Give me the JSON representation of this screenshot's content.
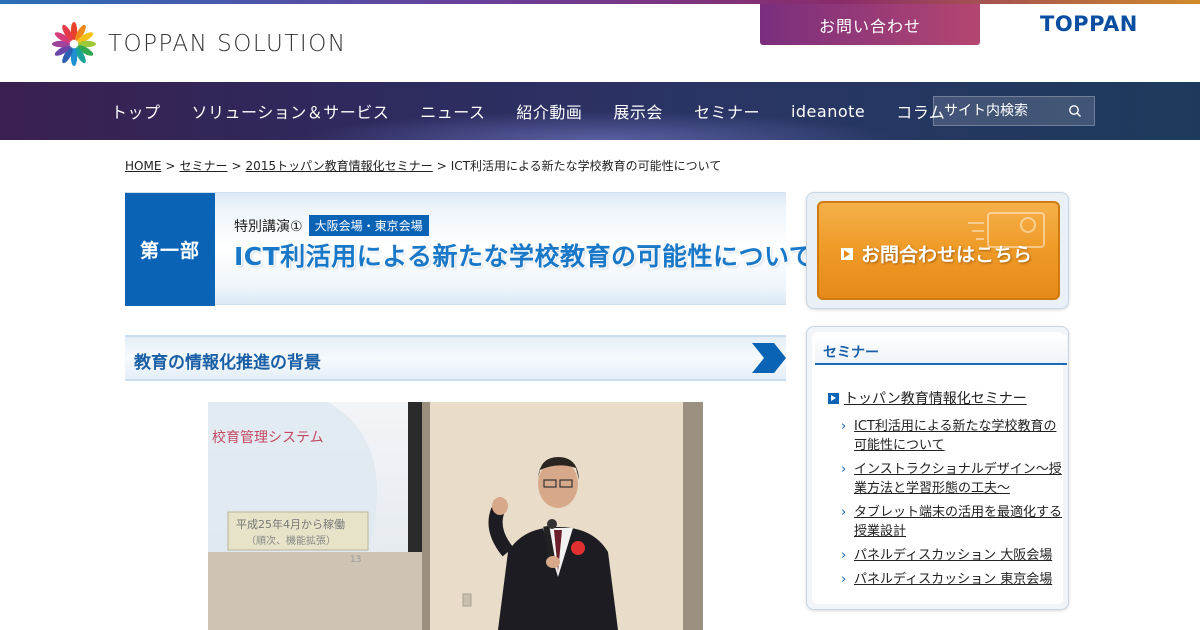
{
  "header": {
    "logo_text": "TOPPAN SOLUTION",
    "contact_button": "お問い合わせ",
    "brand": "TOPPAN"
  },
  "nav": {
    "items": [
      "トップ",
      "ソリューション＆サービス",
      "ニュース",
      "紹介動画",
      "展示会",
      "セミナー",
      "ideanote",
      "コラム"
    ],
    "search_placeholder": "サイト内検索"
  },
  "breadcrumb": {
    "items": [
      "HOME",
      "セミナー",
      "2015トッパン教育情報化セミナー"
    ],
    "current": "ICT利活用による新たな学校教育の可能性について",
    "separator": ">"
  },
  "banner": {
    "part": "第一部",
    "subtitle": "特別講演①",
    "venue": "大阪会場・東京会場",
    "title": "ICT利活用による新たな学校教育の可能性について"
  },
  "section": {
    "heading": "教育の情報化推進の背景"
  },
  "photo": {
    "slide_text": "校育管理システム",
    "slide_box_line1": "平成25年4月から稼働",
    "slide_box_line2": "（順次、機能拡張）",
    "slide_number": "13"
  },
  "sidebar": {
    "contact_label": "お問合わせはこちら",
    "menu_title": "セミナー",
    "parent_item": "トッパン教育情報化セミナー",
    "items": [
      "ICT利活用による新たな学校教育の可能性について",
      "インストラクショナルデザイン〜授業方法と学習形態の工夫〜",
      "タブレット端末の活用を最適化する授業設計",
      "パネルディスカッション 大阪会場",
      "パネルディスカッション 東京会場"
    ]
  },
  "colors": {
    "brand_blue": "#0b63b6",
    "contact_magenta": "#9a3a78",
    "nav_bg": "#2e2a5e",
    "orange": "#ee9a26"
  }
}
